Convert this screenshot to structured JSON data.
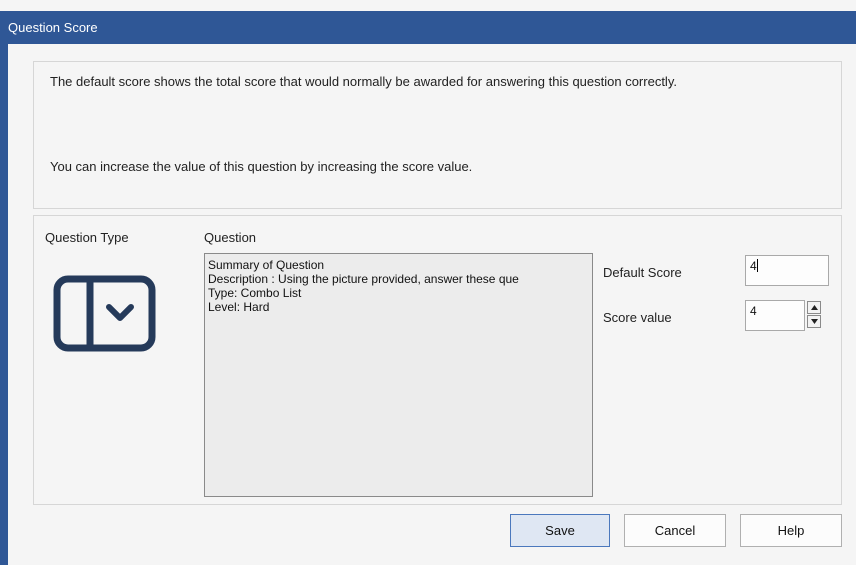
{
  "window": {
    "title": "Question Score"
  },
  "info": {
    "line1": "The default score shows the total score that would normally be awarded for answering this question correctly.",
    "line2": "You can increase the value of this question by increasing the score value."
  },
  "question_type": {
    "label": "Question Type",
    "icon": "combo-list-icon"
  },
  "question": {
    "label": "Question",
    "lines": [
      "Summary of Question",
      "Description : Using the picture provided, answer these que",
      "Type: Combo List",
      "Level: Hard"
    ]
  },
  "default_score": {
    "label": "Default Score",
    "value": "4"
  },
  "score_value": {
    "label": "Score value",
    "value": "4"
  },
  "buttons": {
    "save": "Save",
    "cancel": "Cancel",
    "help": "Help"
  },
  "colors": {
    "titlebar": "#2f5796",
    "icon": "#253a5a",
    "primary_border": "#4b78bd"
  }
}
